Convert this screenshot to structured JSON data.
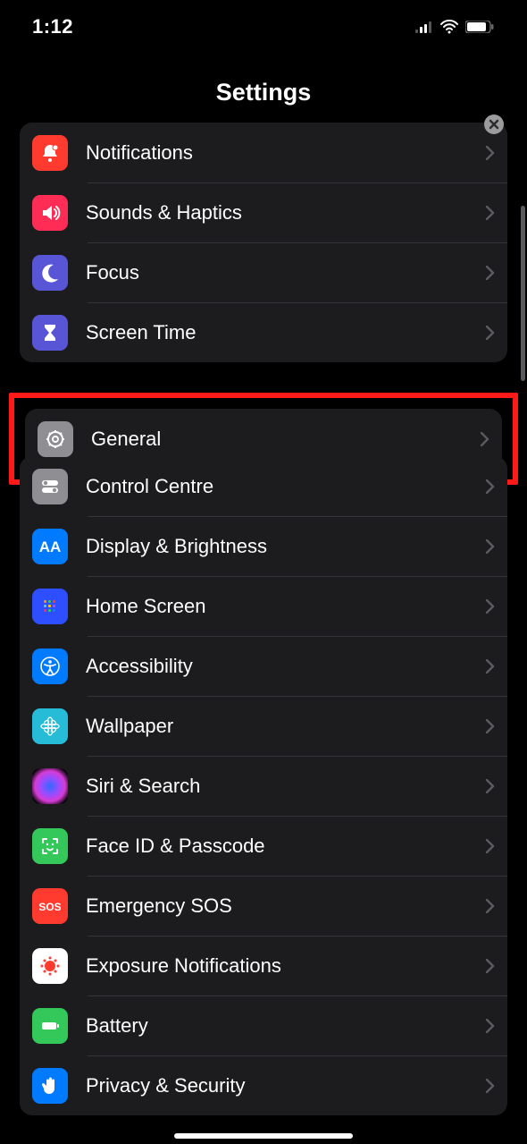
{
  "status": {
    "time": "1:12"
  },
  "header": {
    "title": "Settings"
  },
  "groups": [
    {
      "items": [
        {
          "id": "notifications",
          "label": "Notifications",
          "bg": "bg-red",
          "icon": "bell"
        },
        {
          "id": "sounds",
          "label": "Sounds & Haptics",
          "bg": "bg-pink",
          "icon": "speaker"
        },
        {
          "id": "focus",
          "label": "Focus",
          "bg": "bg-indigo",
          "icon": "moon"
        },
        {
          "id": "screentime",
          "label": "Screen Time",
          "bg": "bg-indigo2",
          "icon": "hourglass"
        }
      ]
    },
    {
      "items": [
        {
          "id": "general",
          "label": "General",
          "bg": "bg-gray",
          "icon": "gear",
          "highlighted": true
        },
        {
          "id": "controlcentre",
          "label": "Control Centre",
          "bg": "bg-gray",
          "icon": "toggles"
        },
        {
          "id": "display",
          "label": "Display & Brightness",
          "bg": "bg-blue",
          "icon": "aa"
        },
        {
          "id": "homescreen",
          "label": "Home Screen",
          "bg": "bg-darkblue",
          "icon": "grid"
        },
        {
          "id": "accessibility",
          "label": "Accessibility",
          "bg": "bg-blue",
          "icon": "access"
        },
        {
          "id": "wallpaper",
          "label": "Wallpaper",
          "bg": "bg-teal",
          "icon": "flower"
        },
        {
          "id": "siri",
          "label": "Siri & Search",
          "bg": "bg-siri",
          "icon": "siri"
        },
        {
          "id": "faceid",
          "label": "Face ID & Passcode",
          "bg": "bg-green",
          "icon": "face"
        },
        {
          "id": "sos",
          "label": "Emergency SOS",
          "bg": "bg-red",
          "icon": "sos"
        },
        {
          "id": "exposure",
          "label": "Exposure Notifications",
          "bg": "bg-white",
          "icon": "exposure"
        },
        {
          "id": "battery",
          "label": "Battery",
          "bg": "bg-green",
          "icon": "battery"
        },
        {
          "id": "privacy",
          "label": "Privacy & Security",
          "bg": "bg-blue",
          "icon": "hand"
        }
      ]
    }
  ]
}
